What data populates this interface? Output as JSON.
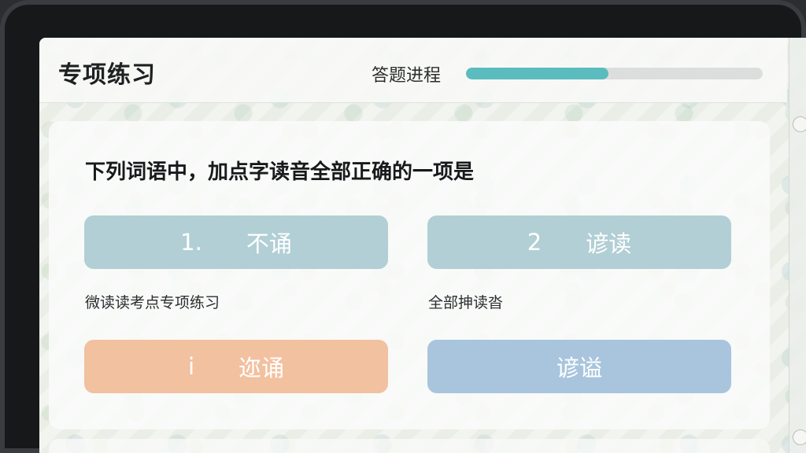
{
  "header": {
    "title": "专项练习",
    "progress_label": "答题进程",
    "progress_fraction": 0.48
  },
  "question": {
    "text": "下列词语中，加点字读音全部正确的一项是"
  },
  "options": [
    {
      "number": "1.",
      "text": "不诵"
    },
    {
      "number": "2",
      "text": "谚读"
    },
    {
      "number": "i",
      "text": "迩诵"
    },
    {
      "number": "",
      "text": "谚谥"
    }
  ],
  "notes": [
    "微读读考点专项练习",
    "全部抻读沓"
  ],
  "colors": {
    "accent": "#5bbcbf",
    "option_teal": "#96bec8",
    "option_orange": "#f0b48c",
    "option_blue": "#96b9d7"
  }
}
